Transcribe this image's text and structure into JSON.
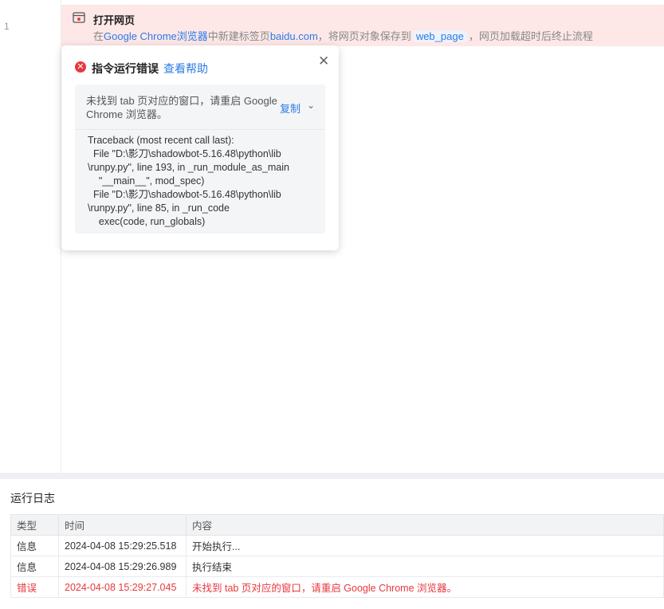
{
  "editor": {
    "line_number": "1",
    "step": {
      "title": "打开网页",
      "desc_prefix": "在",
      "browser": "Google Chrome浏览器",
      "desc_mid": "中新建标签页",
      "url": "baidu.com",
      "desc_save": "，将网页对象保存到",
      "variable": "web_page",
      "desc_suffix": "，网页加载超时后终止流程"
    }
  },
  "error_popup": {
    "title": "指令运行错误",
    "help_link": "查看帮助",
    "message": "未找到 tab 页对应的窗口，请重启 Google Chrome 浏览器。",
    "copy_label": "复制",
    "traceback": "Traceback (most recent call last):\n  File \"D:\\影刀\\shadowbot-5.16.48\\python\\lib\n\\runpy.py\", line 193, in _run_module_as_main\n    \"__main__\", mod_spec)\n  File \"D:\\影刀\\shadowbot-5.16.48\\python\\lib\n\\runpy.py\", line 85, in _run_code\n    exec(code, run_globals)"
  },
  "log": {
    "title": "运行日志",
    "columns": [
      "类型",
      "时间",
      "内容"
    ],
    "rows": [
      {
        "type": "信息",
        "time": "2024-04-08 15:29:25.518",
        "content": "开始执行..."
      },
      {
        "type": "信息",
        "time": "2024-04-08 15:29:26.989",
        "content": "执行结束"
      },
      {
        "type": "错误",
        "time": "2024-04-08 15:29:27.045",
        "content": "未找到 tab 页对应的窗口，请重启 Google Chrome 浏览器。"
      }
    ]
  },
  "colors": {
    "accent": "#2c7be5",
    "error": "#e8383d",
    "step_row_bg": "#fde7e7"
  },
  "icons": {
    "step": "browser-window-icon",
    "error": "error-circle-icon",
    "close": "close-icon",
    "expand": "chevron-down-icon"
  }
}
